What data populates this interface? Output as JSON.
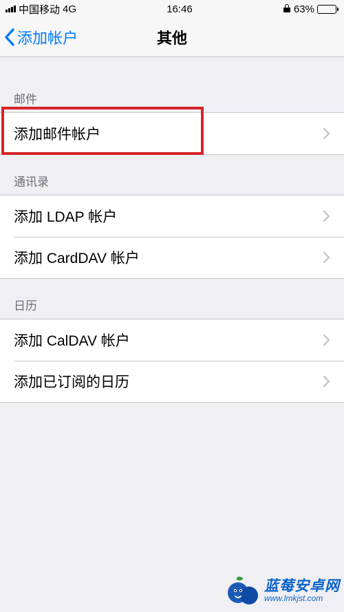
{
  "status": {
    "carrier": "中国移动",
    "network": "4G",
    "time": "16:46",
    "battery_pct": "63%"
  },
  "nav": {
    "back_label": "添加帐户",
    "title": "其他"
  },
  "sections": {
    "mail": {
      "header": "邮件",
      "items": {
        "add_mail": "添加邮件帐户"
      }
    },
    "contacts": {
      "header": "通讯录",
      "items": {
        "add_ldap": "添加 LDAP 帐户",
        "add_carddav": "添加 CardDAV 帐户"
      }
    },
    "calendar": {
      "header": "日历",
      "items": {
        "add_caldav": "添加 CalDAV 帐户",
        "add_subscribed": "添加已订阅的日历"
      }
    }
  },
  "watermark": {
    "title": "蓝莓安卓网",
    "url": "www.lmkjst.com"
  }
}
